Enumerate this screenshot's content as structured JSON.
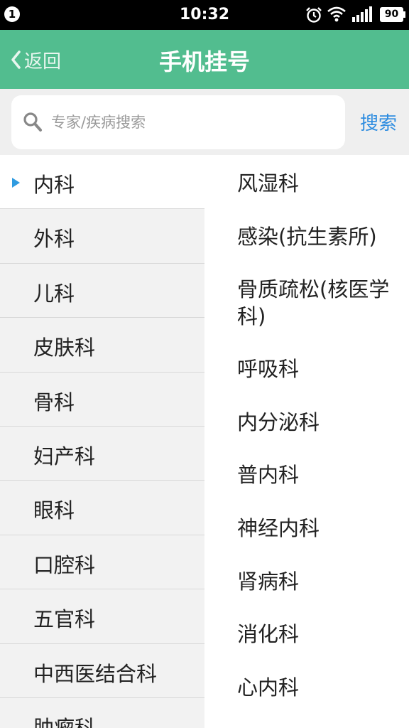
{
  "status_bar": {
    "notification_count": "1",
    "time": "10:32",
    "battery": "90",
    "icons": [
      "alarm-icon",
      "wifi-icon",
      "signal-icon",
      "battery-icon"
    ]
  },
  "header": {
    "back_label": "返回",
    "title": "手机挂号"
  },
  "search": {
    "placeholder": "专家/疾病搜索",
    "value": "",
    "button_label": "搜索"
  },
  "departments": [
    {
      "label": "内科",
      "selected": true
    },
    {
      "label": "外科"
    },
    {
      "label": "儿科"
    },
    {
      "label": "皮肤科"
    },
    {
      "label": "骨科"
    },
    {
      "label": "妇产科"
    },
    {
      "label": "眼科"
    },
    {
      "label": "口腔科"
    },
    {
      "label": "五官科"
    },
    {
      "label": "中西医结合科"
    },
    {
      "label": "肿瘤科"
    }
  ],
  "sub_departments": [
    {
      "label": "风湿科"
    },
    {
      "label": "感染(抗生素所)"
    },
    {
      "label": "骨质疏松(核医学科)"
    },
    {
      "label": "呼吸科"
    },
    {
      "label": "内分泌科"
    },
    {
      "label": "普内科"
    },
    {
      "label": "神经内科"
    },
    {
      "label": "肾病科"
    },
    {
      "label": "消化科"
    },
    {
      "label": "心内科"
    }
  ],
  "colors": {
    "header_bg": "#52bd8f",
    "accent_blue": "#2f8de0",
    "list_bg": "#f2f2f2"
  }
}
